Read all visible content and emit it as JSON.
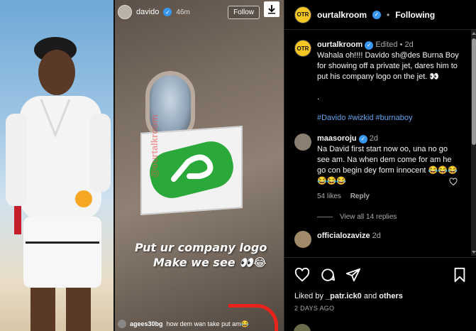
{
  "story": {
    "username": "davido",
    "time": "46m",
    "follow_label": "Follow",
    "caption_line1": "Put ur company logo",
    "caption_line2": "Make  we see 👀😂",
    "watermark": "@ourtalkroom",
    "comment_user": "agees30bg",
    "comment_text": "how dem wan take put am😂"
  },
  "header": {
    "username": "ourtalkroom",
    "logo_text": "OTR",
    "separator": "•",
    "following_label": "Following"
  },
  "post": {
    "username": "ourtalkroom",
    "edited": "Edited",
    "separator": "•",
    "age": "2d",
    "caption": "Wahala oh!!!! Davido sh@des Burna Boy for showing off a private jet, dares him to put his company logo on the jet. 👀",
    "period": ".",
    "hashtags": "#Davido #wizkid #burnaboy"
  },
  "comments": [
    {
      "username": "maasoroju",
      "age": "2d",
      "text": "Na David first start now oo, una no go see am. Na when dem come for am he go con begin dey form innocent 😂😂😂😂😂😂",
      "likes": "54 likes",
      "reply_label": "Reply",
      "view_replies": "View all 14 replies"
    },
    {
      "username": "officialozavize",
      "age": "2d"
    }
  ],
  "actions": {
    "liked_by_prefix": "Liked by",
    "liked_by_user": "_patr.ick0",
    "liked_by_and": "and",
    "liked_by_others": "others",
    "date": "2 DAYS AGO"
  },
  "colors": {
    "background": "#000000",
    "link": "#62a5f2",
    "verified": "#3897f0",
    "muted": "#a8a8a8"
  }
}
